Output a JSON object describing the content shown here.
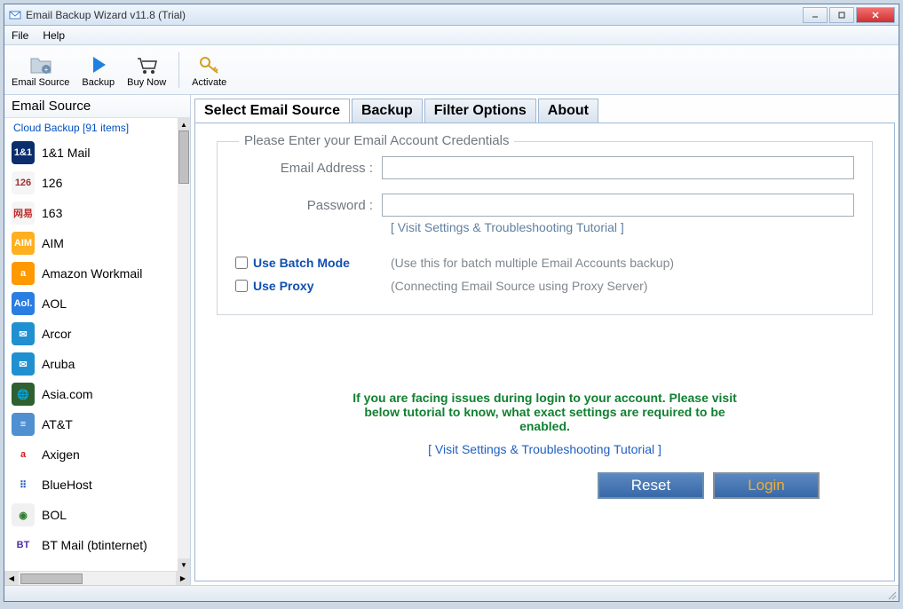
{
  "window": {
    "title": "Email Backup Wizard v11.8 (Trial)"
  },
  "menubar": {
    "file": "File",
    "help": "Help"
  },
  "toolbar": {
    "email_source": "Email Source",
    "backup": "Backup",
    "buy_now": "Buy Now",
    "activate": "Activate"
  },
  "sidebar": {
    "header": "Email Source",
    "cloud_header": "Cloud Backup [91 items]",
    "items": [
      {
        "label": "1&1 Mail",
        "bg": "#0a2d6e",
        "txt": "1&1"
      },
      {
        "label": "126",
        "bg": "#f5f5f5",
        "txt": "126",
        "fc": "#a03030"
      },
      {
        "label": "163",
        "bg": "#f5f5f5",
        "txt": "网易",
        "fc": "#c03030"
      },
      {
        "label": "AIM",
        "bg": "#ffb020",
        "txt": "AIM"
      },
      {
        "label": "Amazon Workmail",
        "bg": "#ff9900",
        "txt": "a"
      },
      {
        "label": "AOL",
        "bg": "#2a7de1",
        "txt": "Aol."
      },
      {
        "label": "Arcor",
        "bg": "#2090d0",
        "txt": "✉",
        "shape": "env"
      },
      {
        "label": "Aruba",
        "bg": "#2090d0",
        "txt": "✉",
        "shape": "env"
      },
      {
        "label": "Asia.com",
        "bg": "#306030",
        "txt": "🌐"
      },
      {
        "label": "AT&T",
        "bg": "#5090d0",
        "txt": "≡"
      },
      {
        "label": "Axigen",
        "bg": "#ffffff",
        "txt": "a",
        "fc": "#d02020"
      },
      {
        "label": "BlueHost",
        "bg": "#ffffff",
        "txt": "⠿",
        "fc": "#2060c0"
      },
      {
        "label": "BOL",
        "bg": "#f0f0f0",
        "txt": "◉",
        "fc": "#308030"
      },
      {
        "label": "BT Mail (btinternet)",
        "bg": "#ffffff",
        "txt": "BT",
        "fc": "#5030a0"
      }
    ]
  },
  "tabs": {
    "select_source": "Select Email Source",
    "backup": "Backup",
    "filter_options": "Filter Options",
    "about": "About"
  },
  "form": {
    "legend": "Please Enter your Email Account Credentials",
    "email_label": "Email Address :",
    "password_label": "Password :",
    "tutorial_link": "[ Visit Settings & Troubleshooting Tutorial ]",
    "batch_label": "Use Batch Mode",
    "batch_hint": "(Use this for batch multiple Email Accounts backup)",
    "proxy_label": "Use Proxy",
    "proxy_hint": "(Connecting Email Source using Proxy Server)"
  },
  "help": {
    "text": "If you are facing issues during login to your account. Please visit below tutorial to know, what exact settings are required to be enabled.",
    "link": "[ Visit Settings & Troubleshooting Tutorial ]"
  },
  "buttons": {
    "reset": "Reset",
    "login": "Login"
  }
}
